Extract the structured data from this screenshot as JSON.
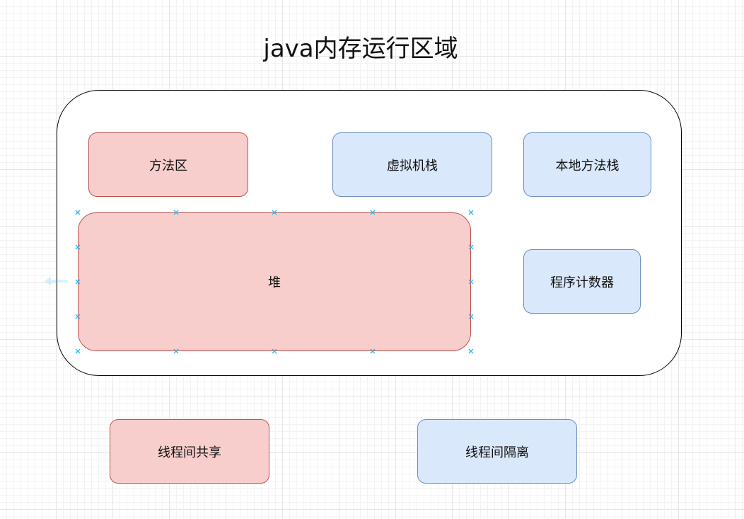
{
  "title": "java内存运行区域",
  "regions": {
    "method_area": "方法区",
    "vm_stack": "虚拟机栈",
    "native_stack": "本地方法栈",
    "heap": "堆",
    "pc_register": "程序计数器"
  },
  "legend": {
    "shared": "线程间共享",
    "isolated": "线程间隔离"
  },
  "colors": {
    "shared_fill": "#f8cecc",
    "shared_stroke": "#b85450",
    "isolated_fill": "#dae8fc",
    "isolated_stroke": "#6c8ebf",
    "selection_handle": "#29b6f2"
  }
}
